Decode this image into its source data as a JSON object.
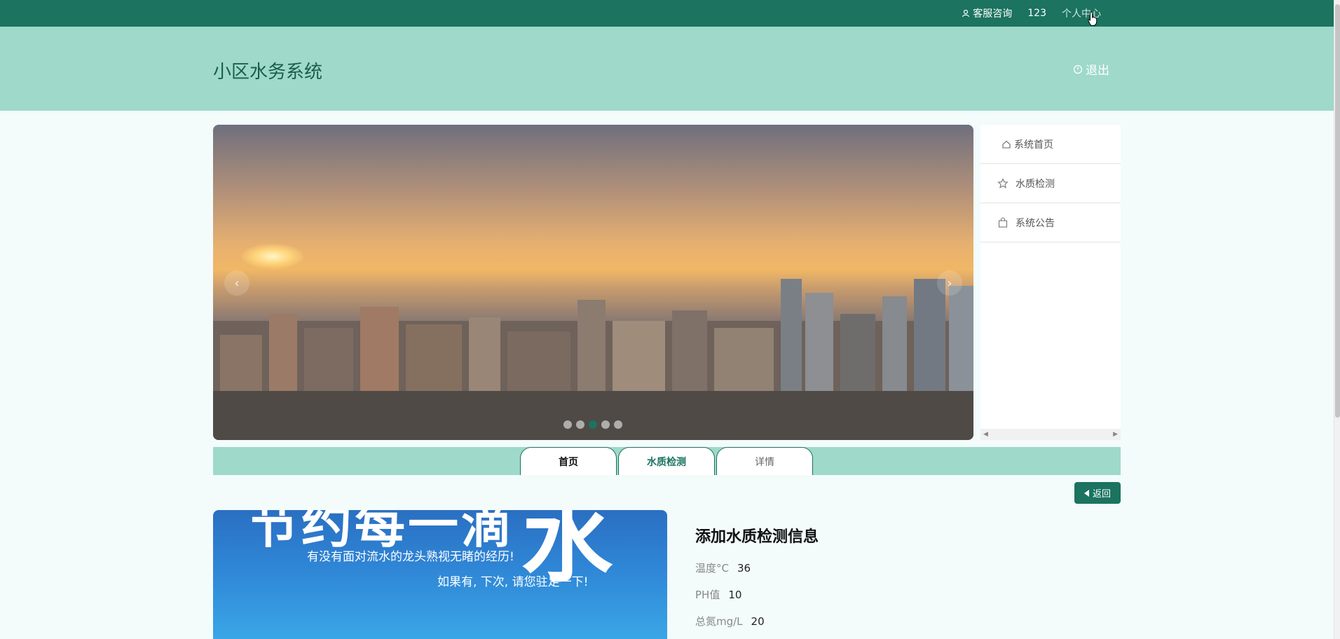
{
  "topbar": {
    "service": "客服咨询",
    "username": "123",
    "profile": "个人中心"
  },
  "header": {
    "title": "小区水务系统",
    "logout": "退出"
  },
  "banner": {
    "prev": "‹",
    "next": "›",
    "active_dot": 3,
    "dot_count": 5
  },
  "sidebar": {
    "items": [
      {
        "label": "系统首页",
        "icon": "home-icon"
      },
      {
        "label": "水质检测",
        "icon": "star-icon"
      },
      {
        "label": "系统公告",
        "icon": "bag-icon"
      }
    ]
  },
  "tabs": [
    {
      "label": "首页"
    },
    {
      "label": "水质检测"
    },
    {
      "label": "详情"
    }
  ],
  "back_button": "返回",
  "promo": {
    "big_text": "节约每一滴",
    "big_water": "水",
    "line1": "有没有面对流水的龙头熟视无睹的经历!",
    "line2": "如果有, 下次, 请您驻足一下!"
  },
  "detail": {
    "title": "添加水质检测信息",
    "fields": [
      {
        "label": "温度°C",
        "value": "36"
      },
      {
        "label": "PH值",
        "value": "10"
      },
      {
        "label": "总氮mg/L",
        "value": "20"
      }
    ]
  },
  "colors": {
    "primary": "#1b7360",
    "header_bg": "#9ed9c9",
    "page_bg": "#f3fbfb"
  }
}
